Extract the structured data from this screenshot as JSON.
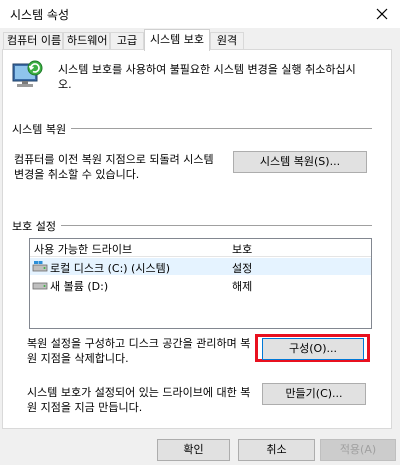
{
  "window": {
    "title": "시스템 속성"
  },
  "tabs": [
    {
      "label": "컴퓨터 이름",
      "active": false
    },
    {
      "label": "하드웨어",
      "active": false
    },
    {
      "label": "고급",
      "active": false
    },
    {
      "label": "시스템 보호",
      "active": true
    },
    {
      "label": "원격",
      "active": false
    }
  ],
  "intro": {
    "text": "시스템 보호를 사용하여 불필요한 시스템 변경을 실행 취소하십시오."
  },
  "restore": {
    "group_label": "시스템 복원",
    "description": "컴퓨터를 이전 복원 지점으로 되돌려 시스템 변경을 취소할 수 있습니다.",
    "button_label": "시스템 복원(S)..."
  },
  "protection": {
    "group_label": "보호 설정",
    "columns": [
      "사용 가능한 드라이브",
      "보호"
    ],
    "drives": [
      {
        "name": "로컬 디스크 (C:) (시스템)",
        "status": "설정",
        "selected": true
      },
      {
        "name": "새 볼륨 (D:)",
        "status": "해제",
        "selected": false
      }
    ],
    "configure_text": "복원 설정을 구성하고 디스크 공간을 관리하며 복원 지점을 삭제합니다.",
    "configure_button": "구성(O)...",
    "create_text": "시스템 보호가 설정되어 있는 드라이브에 대한 복원 지점을 지금 만듭니다.",
    "create_button": "만들기(C)..."
  },
  "footer": {
    "ok": "확인",
    "cancel": "취소",
    "apply": "적용(A)"
  },
  "colors": {
    "highlight": "#e8101f",
    "selected_row": "#e5f3ff",
    "focus": "#0078d7"
  }
}
